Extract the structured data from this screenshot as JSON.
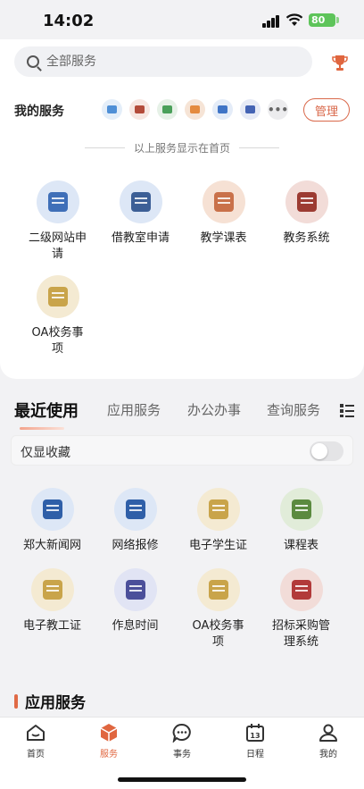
{
  "status": {
    "time": "14:02",
    "battery": "80"
  },
  "search": {
    "placeholder": "全部服务"
  },
  "my_services": {
    "title": "我的服务",
    "manage_label": "管理",
    "mini_icons": [
      {
        "name": "web-apply-mini-icon",
        "bg": "#e4eef9",
        "fg": "#4f8fd6"
      },
      {
        "name": "classroom-mini-icon",
        "bg": "#f7e6e1",
        "fg": "#b34b3a"
      },
      {
        "name": "mail-mini-icon",
        "bg": "#e6f1e7",
        "fg": "#4aa05a"
      },
      {
        "name": "schedule-mini-icon",
        "bg": "#f6e4d6",
        "fg": "#e48a3e"
      },
      {
        "name": "office-mini-icon",
        "bg": "#e4ecf8",
        "fg": "#3f74c6"
      },
      {
        "name": "document-mini-icon",
        "bg": "#e6eaf6",
        "fg": "#4463b4"
      },
      {
        "name": "more-mini-icon",
        "bg": "#ececee",
        "fg": "#666666"
      }
    ],
    "note": "以上服务显示在首页",
    "items": [
      {
        "label": "二级网站申请",
        "icon": "website-apply-icon",
        "bg": "#dde7f6",
        "fg": "#3f6fb8"
      },
      {
        "label": "借教室申请",
        "icon": "classroom-icon",
        "bg": "#dde7f6",
        "fg": "#3c5f96"
      },
      {
        "label": "教学课表",
        "icon": "timetable-icon",
        "bg": "#f6e1d4",
        "fg": "#c9714a"
      },
      {
        "label": "教务系统",
        "icon": "academic-system-icon",
        "bg": "#f2dcd8",
        "fg": "#9c3b32"
      },
      {
        "label": "OA校务事项",
        "icon": "oa-affairs-icon",
        "bg": "#f4ead2",
        "fg": "#c9a44a"
      }
    ]
  },
  "tabs": [
    "最近使用",
    "应用服务",
    "办公办事",
    "查询服务"
  ],
  "favorites_only": {
    "label": "仅显收藏"
  },
  "recent": [
    {
      "label": "郑大新闻网",
      "icon": "news-icon",
      "bg": "#dde7f6",
      "fg": "#2f5fa8"
    },
    {
      "label": "网络报修",
      "icon": "network-repair-icon",
      "bg": "#dde7f6",
      "fg": "#2f5fa8"
    },
    {
      "label": "电子学生证",
      "icon": "student-card-icon",
      "bg": "#f4ead2",
      "fg": "#c9a44a"
    },
    {
      "label": "课程表",
      "icon": "course-table-icon",
      "bg": "#e1ecd9",
      "fg": "#5b8a3f"
    },
    {
      "label": "电子教工证",
      "icon": "staff-card-icon",
      "bg": "#f4ead2",
      "fg": "#c9a44a"
    },
    {
      "label": "作息时间",
      "icon": "routine-icon",
      "bg": "#e1e4f4",
      "fg": "#4b4f9a"
    },
    {
      "label": "OA校务事项",
      "icon": "oa-affairs-icon",
      "bg": "#f4ead2",
      "fg": "#c9a44a"
    },
    {
      "label": "招标采购管理系统",
      "icon": "procurement-icon",
      "bg": "#f2dcd8",
      "fg": "#b23a3a"
    }
  ],
  "section_title": "应用服务",
  "nav": [
    {
      "label": "首页",
      "icon": "home-icon"
    },
    {
      "label": "服务",
      "icon": "service-cube-icon"
    },
    {
      "label": "事务",
      "icon": "chat-icon"
    },
    {
      "label": "日程",
      "icon": "calendar-icon"
    },
    {
      "label": "我的",
      "icon": "profile-icon"
    }
  ],
  "colors": {
    "accent": "#e0663f",
    "manage": "#d9684a"
  }
}
